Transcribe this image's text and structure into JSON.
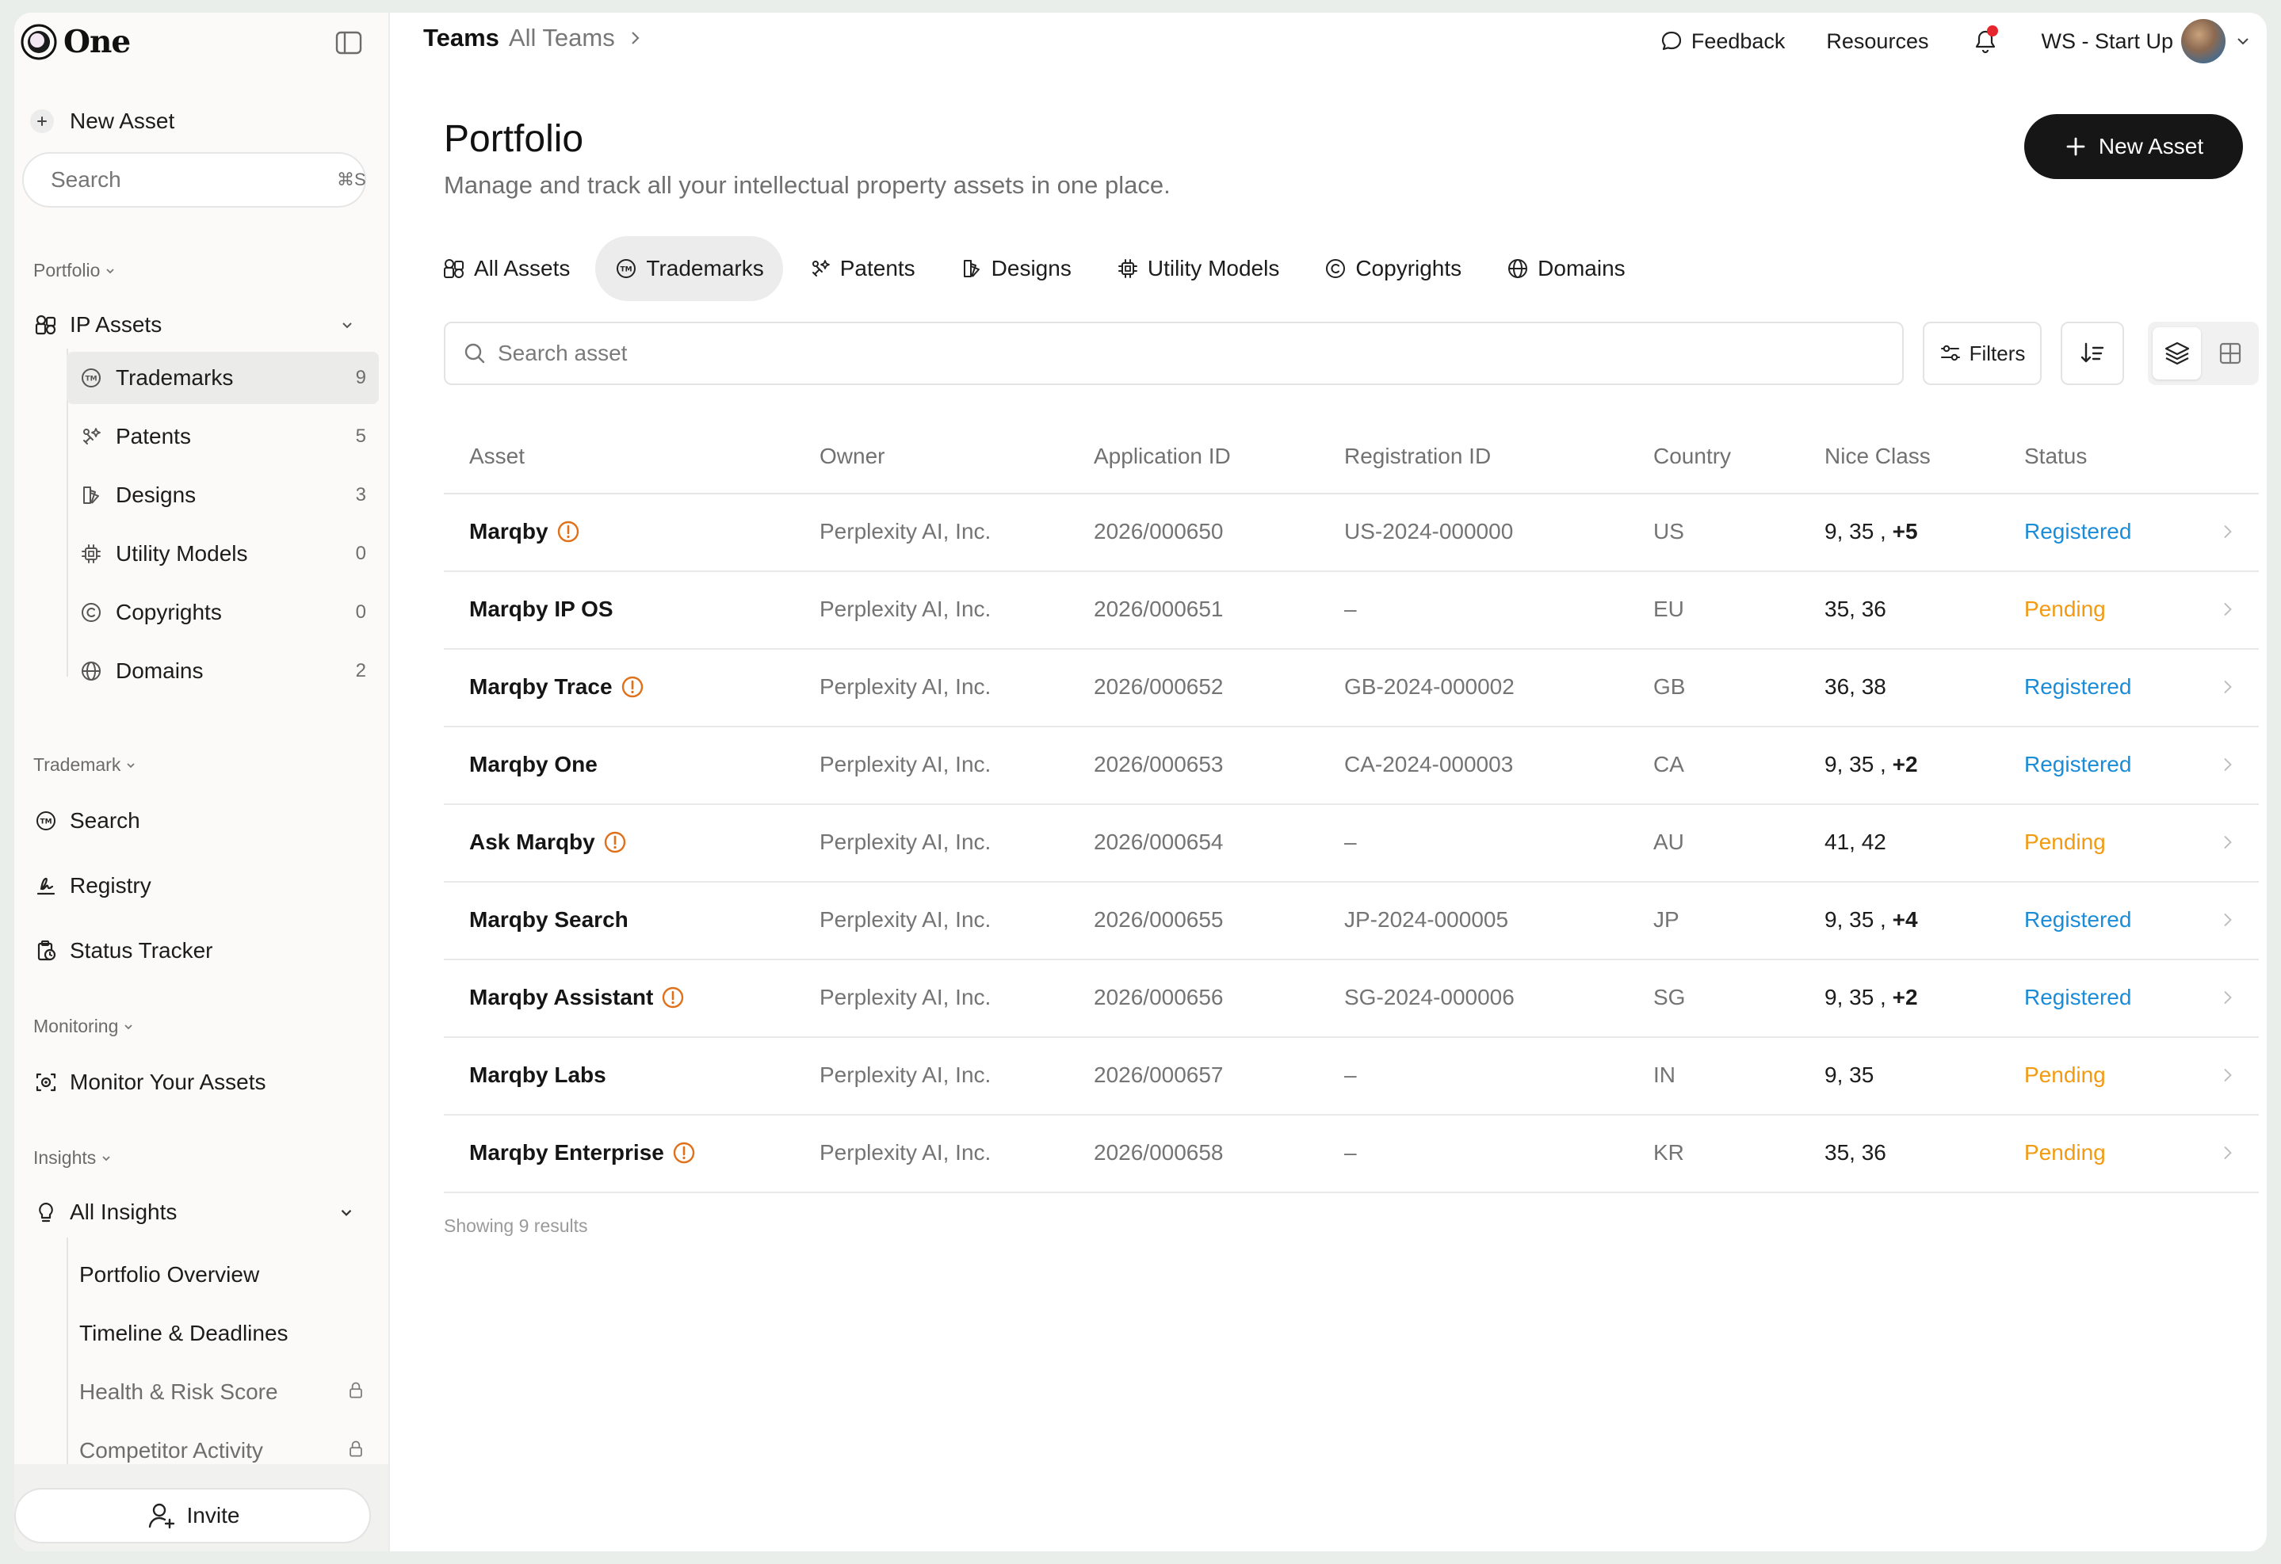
{
  "brand": {
    "name": "One"
  },
  "sidebar": {
    "new_asset_label": "New Asset",
    "search_placeholder": "Search",
    "search_shortcut": "⌘S",
    "portfolio_section": "Portfolio",
    "ip_assets_label": "IP Assets",
    "ip_items": [
      {
        "label": "Trademarks",
        "count": "9",
        "icon": "trademark-icon",
        "active": true
      },
      {
        "label": "Patents",
        "count": "5",
        "icon": "patent-icon"
      },
      {
        "label": "Designs",
        "count": "3",
        "icon": "design-icon"
      },
      {
        "label": "Utility Models",
        "count": "0",
        "icon": "chip-icon"
      },
      {
        "label": "Copyrights",
        "count": "0",
        "icon": "copyright-icon"
      },
      {
        "label": "Domains",
        "count": "2",
        "icon": "globe-icon"
      }
    ],
    "trademark_section": "Trademark",
    "trademark_items": [
      {
        "label": "Search",
        "icon": "trademark-icon"
      },
      {
        "label": "Registry",
        "icon": "signature-icon"
      },
      {
        "label": "Status Tracker",
        "icon": "clipboard-clock-icon"
      }
    ],
    "monitoring_section": "Monitoring",
    "monitoring_items": [
      {
        "label": "Monitor Your Assets",
        "icon": "scan-eye-icon"
      }
    ],
    "insights_section": "Insights",
    "all_insights_label": "All Insights",
    "insight_items": [
      {
        "label": "Portfolio Overview",
        "locked": false
      },
      {
        "label": "Timeline & Deadlines",
        "locked": false
      },
      {
        "label": "Health & Risk Score",
        "locked": true
      },
      {
        "label": "Competitor Activity",
        "locked": true
      }
    ],
    "invite_label": "Invite"
  },
  "topbar": {
    "crumb_team": "Teams",
    "crumb_current": "All Teams",
    "feedback_label": "Feedback",
    "resources_label": "Resources",
    "workspace_label": "WS - Start Up"
  },
  "page": {
    "title": "Portfolio",
    "subtitle": "Manage and track all your intellectual property assets in one place.",
    "new_asset_label": "New Asset",
    "tabs": [
      {
        "label": "All Assets",
        "icon": "assets-icon"
      },
      {
        "label": "Trademarks",
        "icon": "trademark-icon",
        "active": true
      },
      {
        "label": "Patents",
        "icon": "patent-icon"
      },
      {
        "label": "Designs",
        "icon": "design-icon"
      },
      {
        "label": "Utility Models",
        "icon": "chip-icon"
      },
      {
        "label": "Copyrights",
        "icon": "copyright-icon"
      },
      {
        "label": "Domains",
        "icon": "globe-icon"
      }
    ],
    "asset_search_placeholder": "Search asset",
    "filters_label": "Filters",
    "results_text": "Showing 9 results"
  },
  "table": {
    "columns": [
      "Asset",
      "Owner",
      "Application ID",
      "Registration ID",
      "Country",
      "Nice Class",
      "Status"
    ],
    "rows": [
      {
        "asset": "Marqby",
        "warn": true,
        "owner": "Perplexity AI, Inc.",
        "app_id": "2026/000650",
        "reg_id": "US-2024-000000",
        "country": "US",
        "nice": "9, 35 ,",
        "nice_extra": "+5",
        "status": "Registered"
      },
      {
        "asset": "Marqby IP OS",
        "warn": false,
        "owner": "Perplexity AI, Inc.",
        "app_id": "2026/000651",
        "reg_id": "–",
        "country": "EU",
        "nice": "35, 36",
        "nice_extra": "",
        "status": "Pending"
      },
      {
        "asset": "Marqby Trace",
        "warn": true,
        "owner": "Perplexity AI, Inc.",
        "app_id": "2026/000652",
        "reg_id": "GB-2024-000002",
        "country": "GB",
        "nice": "36, 38",
        "nice_extra": "",
        "status": "Registered"
      },
      {
        "asset": "Marqby One",
        "warn": false,
        "owner": "Perplexity AI, Inc.",
        "app_id": "2026/000653",
        "reg_id": "CA-2024-000003",
        "country": "CA",
        "nice": "9, 35 ,",
        "nice_extra": "+2",
        "status": "Registered"
      },
      {
        "asset": "Ask Marqby",
        "warn": true,
        "owner": "Perplexity AI, Inc.",
        "app_id": "2026/000654",
        "reg_id": "–",
        "country": "AU",
        "nice": "41, 42",
        "nice_extra": "",
        "status": "Pending"
      },
      {
        "asset": "Marqby Search",
        "warn": false,
        "owner": "Perplexity AI, Inc.",
        "app_id": "2026/000655",
        "reg_id": "JP-2024-000005",
        "country": "JP",
        "nice": "9, 35 ,",
        "nice_extra": "+4",
        "status": "Registered"
      },
      {
        "asset": "Marqby Assistant",
        "warn": true,
        "owner": "Perplexity AI, Inc.",
        "app_id": "2026/000656",
        "reg_id": "SG-2024-000006",
        "country": "SG",
        "nice": "9, 35 ,",
        "nice_extra": "+2",
        "status": "Registered"
      },
      {
        "asset": "Marqby Labs",
        "warn": false,
        "owner": "Perplexity AI, Inc.",
        "app_id": "2026/000657",
        "reg_id": "–",
        "country": "IN",
        "nice": "9, 35",
        "nice_extra": "",
        "status": "Pending"
      },
      {
        "asset": "Marqby Enterprise",
        "warn": true,
        "owner": "Perplexity AI, Inc.",
        "app_id": "2026/000658",
        "reg_id": "–",
        "country": "KR",
        "nice": "35, 36",
        "nice_extra": "",
        "status": "Pending"
      }
    ]
  },
  "colors": {
    "registered": "#1a8cd8",
    "pending": "#f29a12",
    "warning": "#e0701a",
    "notification_dot": "#e6262c",
    "primary_button": "#161616"
  }
}
